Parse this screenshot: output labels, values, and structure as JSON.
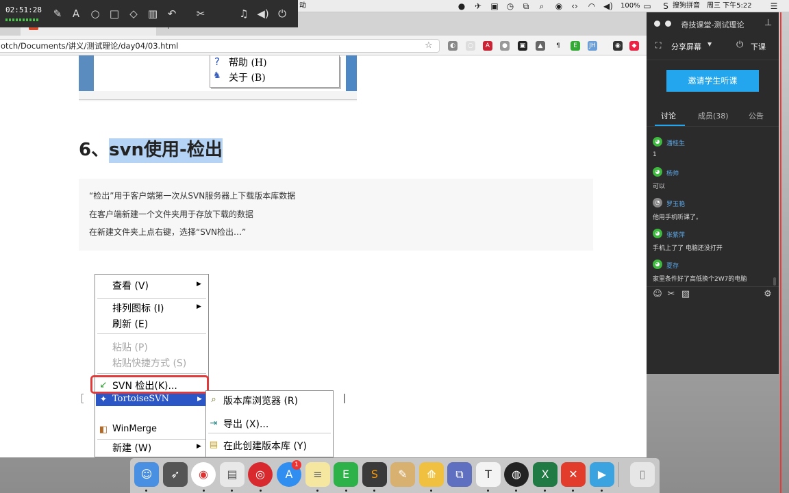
{
  "recorder": {
    "time": "02:51:28"
  },
  "menubar": {
    "partial_text": "动",
    "battery": "100%",
    "input_method": "搜狗拼音",
    "datetime": "周三 下午5:22"
  },
  "browser": {
    "url": "otch/Documents/讲义/测试理论/day04/03.html",
    "tab_partial": "..."
  },
  "page": {
    "top_menu": {
      "item1": "帮助 (H)",
      "item2": "关于 (B)"
    },
    "heading": {
      "prefix": "6、",
      "highlighted": "svn使用-检出"
    },
    "quote_lines": [
      "“检出”用于客户端第一次从SVN服务器上下载版本库数据",
      "在客户端新建一个文件夹用于存放下载的数据",
      "在新建文件夹上点右键，选择“SVN检出…”"
    ],
    "context_menu": {
      "view": "查看 (V)",
      "arrange": "排列图标 (I)",
      "refresh": "刷新 (E)",
      "paste": "粘贴 (P)",
      "paste_shortcut": "粘贴快捷方式 (S)",
      "svn_checkout": "SVN 检出(K)...",
      "tortoise": "TortoiseSVN",
      "winmerge": "WinMerge",
      "new": "新建 (W)"
    },
    "submenu": {
      "repo_browser": "版本库浏览器 (R)",
      "export": "导出 (X)...",
      "create_repo": "在此创建版本库 (Y)"
    }
  },
  "panel": {
    "title": "奇技课堂-测试理论",
    "share_screen": "分享屏幕",
    "end_class": "下课",
    "invite": "邀请学生听课",
    "tabs": [
      "讨论",
      "成员(38)",
      "公告"
    ],
    "messages": [
      {
        "name": "潘桂生",
        "text": "1"
      },
      {
        "name": "杨帅",
        "text": "可以"
      },
      {
        "name": "罗玉艳",
        "text": "他用手机听课了。"
      },
      {
        "name": "张紫萍",
        "text": "手机上了了  电脑还没打开"
      },
      {
        "name": "夏存",
        "text": "家里条件好了高低换个2W7的电脑"
      }
    ]
  },
  "dock": {
    "badge": "1",
    "apps": [
      "finder",
      "launchpad",
      "chrome",
      "preview",
      "netease-music",
      "app-store",
      "notes",
      "evernote",
      "sublime",
      "tools",
      "maps",
      "vmware",
      "typora",
      "obs",
      "excel",
      "xmind",
      "paw",
      "trash"
    ]
  },
  "colors": {
    "accent": "#23a6ee",
    "highlight_border": "#e03b3b",
    "wechat_green": "#3fb83f"
  }
}
